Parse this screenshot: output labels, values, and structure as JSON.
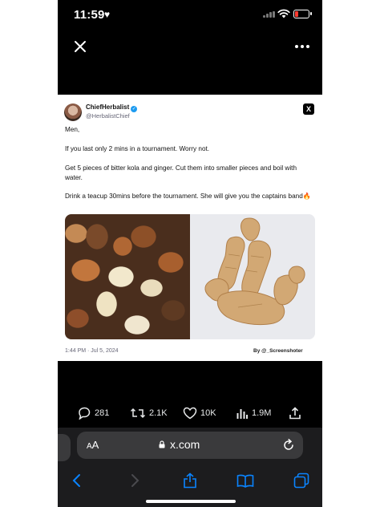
{
  "status_bar": {
    "time": "11:59",
    "heart_icon": "heart-icon",
    "battery_color": "#ff3b30"
  },
  "top_bar": {
    "close_icon": "close-icon",
    "more_icon": "more-dots-icon"
  },
  "tweet": {
    "author_name": "ChiefHerbalist",
    "author_handle": "@HerbalistChief",
    "paragraphs": [
      "Men,",
      "If you last only 2 mins in a tournament. Worry not.",
      "Get 5 pieces of bitter kola and ginger. Cut them into smaller pieces and boil with water.",
      "Drink a teacup 30mins before the tournament.  She will give you the captains band🔥"
    ],
    "images": [
      "bitter-kola-nuts-photo",
      "ginger-root-photo"
    ],
    "timestamp": "1:44 PM · Jul 5, 2024",
    "credit": "By @_Screenshoter",
    "logo": "X"
  },
  "actions": {
    "replies": "281",
    "reposts": "2.1K",
    "likes": "10K",
    "views": "1.9M"
  },
  "browser": {
    "aa_label_a": "A",
    "aa_label_b": "A",
    "url": "x.com",
    "accent": "#0a84ff"
  }
}
